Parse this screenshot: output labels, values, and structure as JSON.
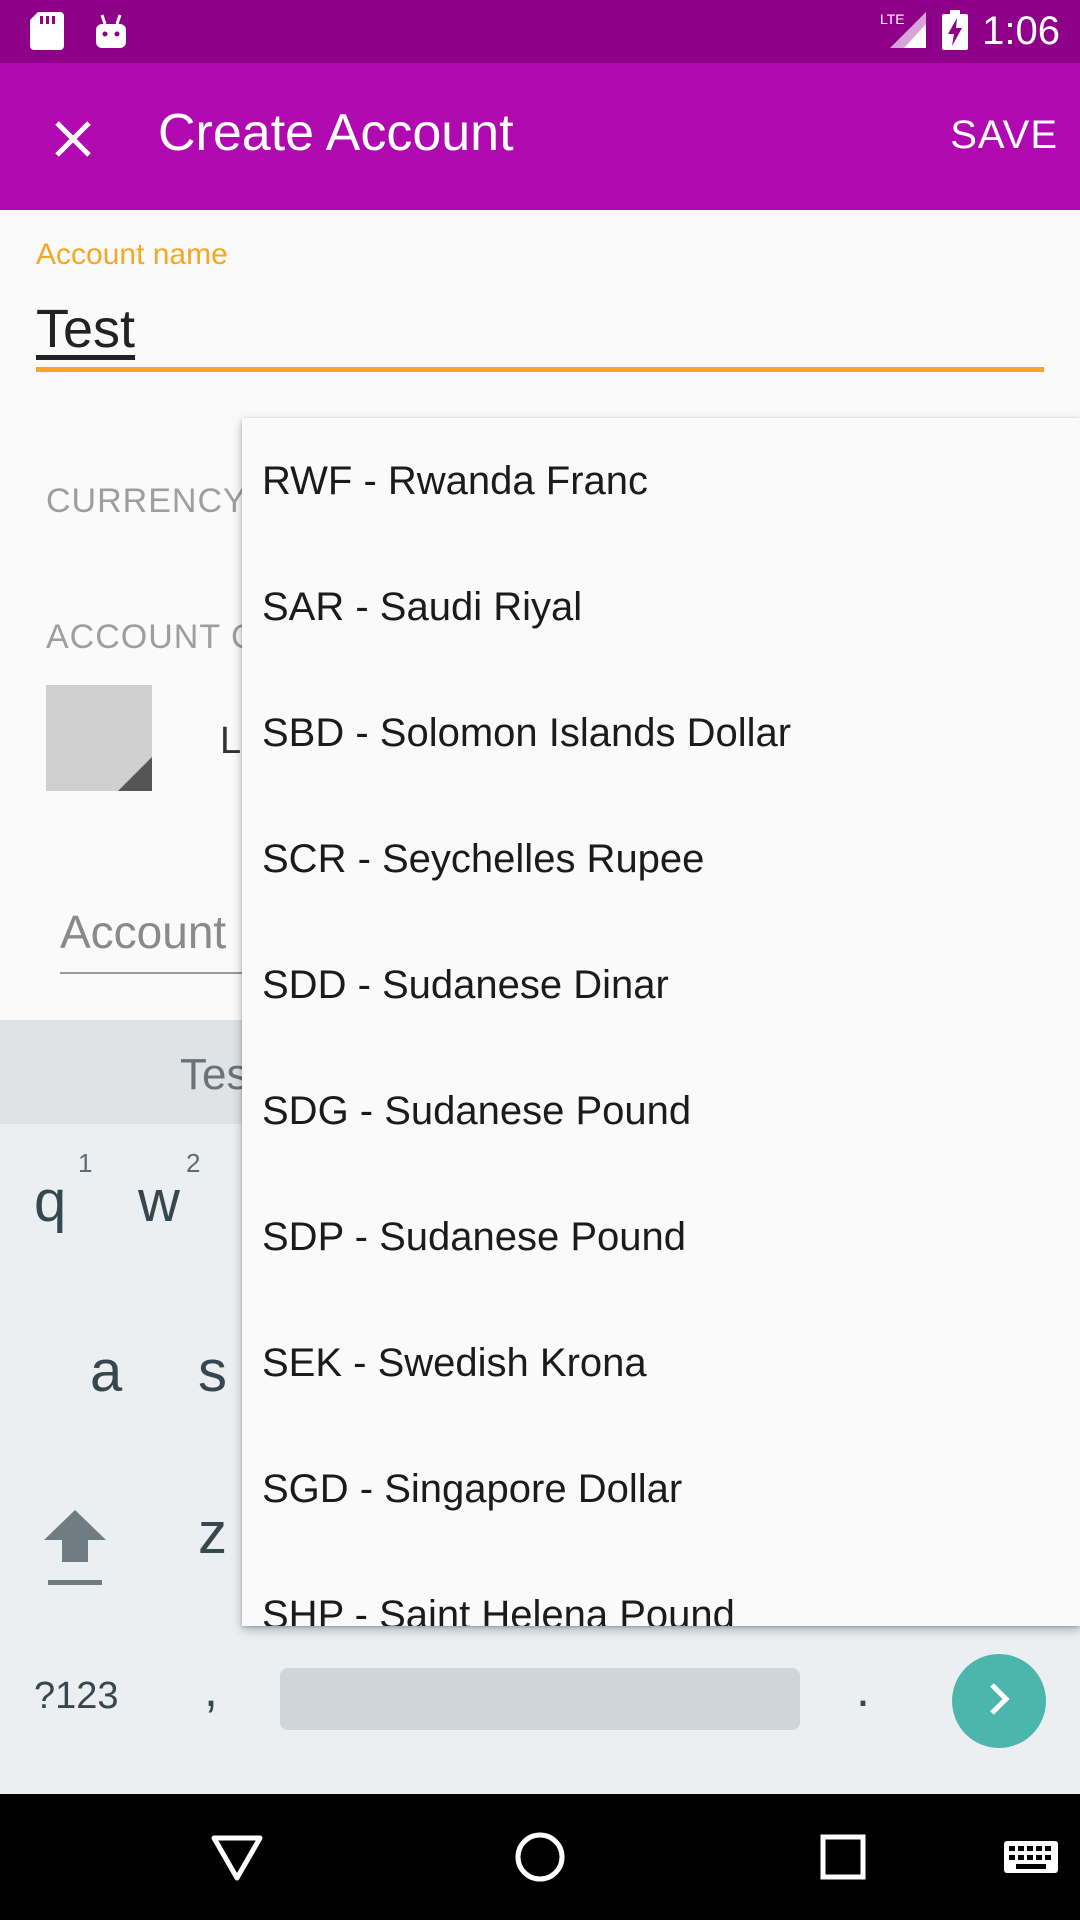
{
  "status_bar": {
    "time": "1:06",
    "network": "LTE",
    "icons": [
      "sd-card-icon",
      "android-icon",
      "signal-icon",
      "battery-charging-icon"
    ]
  },
  "toolbar": {
    "title": "Create Account",
    "save_label": "SAVE",
    "close_icon": "close-icon"
  },
  "form": {
    "account_name_label": "Account name",
    "account_name_value": "Test",
    "currency_label": "CURRENCY",
    "account_color_label": "ACCOUNT C",
    "color_text": "L",
    "account_input_placeholder": "Account"
  },
  "keyboard": {
    "suggestion": "Tes",
    "row1": [
      {
        "key": "q",
        "hint": "1"
      },
      {
        "key": "w",
        "hint": "2"
      }
    ],
    "row2": [
      "a",
      "s"
    ],
    "row3": [
      "z"
    ],
    "symbols_label": "?123",
    "comma": ",",
    "period": "."
  },
  "currency_dropdown": {
    "items": [
      "RWF - Rwanda Franc",
      "SAR - Saudi Riyal",
      "SBD - Solomon Islands Dollar",
      "SCR - Seychelles Rupee",
      "SDD - Sudanese Dinar",
      "SDG - Sudanese Pound",
      "SDP - Sudanese Pound",
      "SEK - Swedish Krona",
      "SGD - Singapore Dollar",
      "SHP - Saint Helena Pound"
    ]
  },
  "nav_bar": {
    "icons": [
      "back-icon",
      "home-icon",
      "recents-icon",
      "keyboard-icon"
    ]
  },
  "colors": {
    "status_bar": "#8e0087",
    "toolbar": "#b009b0",
    "accent": "#f5a623",
    "enter_key": "#4db6ac"
  }
}
